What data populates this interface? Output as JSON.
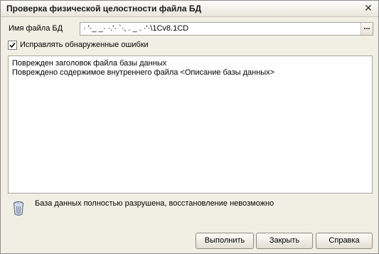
{
  "window": {
    "title": "Проверка физической целостности файла БД"
  },
  "file": {
    "label": "Имя файла БД",
    "value": "·  '·_  _·  ·.'·  `·,  .  _  .  ·'·\\1Cv8.1CD",
    "browse_label": "..."
  },
  "fix_errors": {
    "label": "Исправлять обнаруженные ошибки",
    "checked": true
  },
  "messages": [
    "Поврежден заголовок файла базы данных",
    "Повреждено содержимое внутреннего файла <Описание базы данных>"
  ],
  "status": {
    "icon": "trash-bin-icon",
    "text": "База данных полностью разрушена, восстановление невозможно"
  },
  "buttons": {
    "run": "Выполнить",
    "close": "Закрыть",
    "help": "Справка"
  }
}
